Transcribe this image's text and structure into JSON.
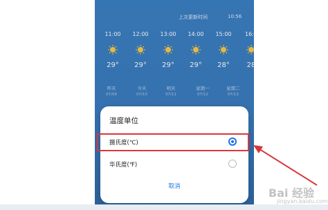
{
  "header": {
    "updated_label": "上次更新时间",
    "updated_time": "10:56"
  },
  "hourly": [
    {
      "time": "11:00",
      "temp": "29°",
      "icon": "sun-icon"
    },
    {
      "time": "12:00",
      "temp": "29°",
      "icon": "sun-icon"
    },
    {
      "time": "13:00",
      "temp": "29°",
      "icon": "sun-icon"
    },
    {
      "time": "14:00",
      "temp": "29°",
      "icon": "sun-icon"
    },
    {
      "time": "15:00",
      "temp": "28°",
      "icon": "sun-icon"
    },
    {
      "time": "16:0",
      "temp": "28",
      "icon": "sun-icon"
    }
  ],
  "daily": [
    {
      "day": "昨天",
      "date": "07/09"
    },
    {
      "day": "今天",
      "date": "07/10"
    },
    {
      "day": "明天",
      "date": "07/11"
    },
    {
      "day": "星期一",
      "date": "07/12"
    },
    {
      "day": "星期二",
      "date": "07/13"
    }
  ],
  "dialog": {
    "title": "温度单位",
    "options": [
      {
        "label": "摄氏度(℃)",
        "checked": true
      },
      {
        "label": "华氏度(℉)",
        "checked": false
      }
    ],
    "cancel": "取消"
  },
  "watermark": {
    "text": "Bai 经验",
    "subtext": "jingyan.baidu.com"
  },
  "colors": {
    "accent": "#1a73e8",
    "highlight": "#d9363e",
    "sky": "#3b7fc3"
  }
}
